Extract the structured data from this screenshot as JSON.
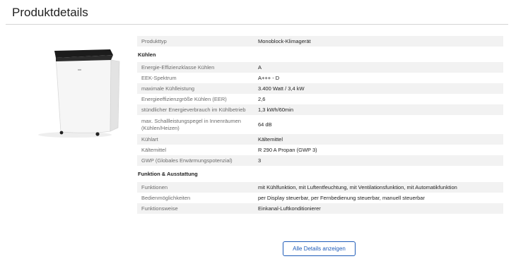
{
  "page": {
    "title": "Produktdetails",
    "button_label": "Alle Details anzeigen"
  },
  "specs": {
    "top": {
      "key": "Produkttyp",
      "value": "Monoblock-Klimagerät"
    },
    "section_cooling": "Kühlen",
    "cooling": [
      {
        "key": "Energie-Effizienzklasse Kühlen",
        "value": "A"
      },
      {
        "key": "EEK-Spektrum",
        "value": "A+++ - D"
      },
      {
        "key": "maximale Kühlleistung",
        "value": "3.400 Watt / 3,4 kW"
      },
      {
        "key": "Energieeffizienzgröße Kühlen (EER)",
        "value": "2,6"
      },
      {
        "key": "stündlicher Energieverbrauch im Kühlbetrieb",
        "value": "1,3 kWh/60min"
      },
      {
        "key": "max. Schallleistungspegel in Innenräumen (Kühlen/Heizen)",
        "value": "64 dB"
      },
      {
        "key": "Kühlart",
        "value": "Kältemittel"
      },
      {
        "key": "Kältemittel",
        "value": "R 290 A Propan (GWP 3)"
      },
      {
        "key": "GWP (Globales Erwärmungspotenzial)",
        "value": "3"
      }
    ],
    "section_features": "Funktion & Ausstattung",
    "features": [
      {
        "key": "Funktionen",
        "value": "mit Kühlfunktion, mit Luftentfeuchtung, mit Ventilationsfunktion, mit Automatikfunktion"
      },
      {
        "key": "Bedienmöglichkeiten",
        "value": "per Display steuerbar, per Fernbedienung steuerbar, manuell steuerbar"
      },
      {
        "key": "Funktionsweise",
        "value": "Einkanal-Luftkonditionierer"
      }
    ]
  }
}
